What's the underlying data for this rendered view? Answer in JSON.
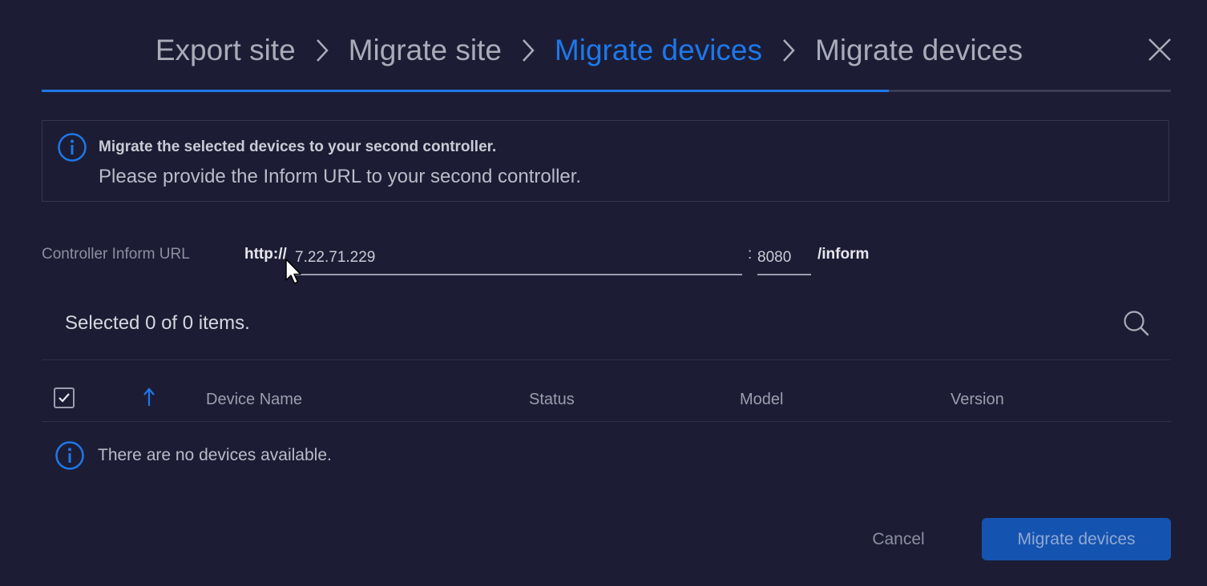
{
  "wizard": {
    "steps": [
      {
        "label": "Export site",
        "active": false
      },
      {
        "label": "Migrate site",
        "active": false
      },
      {
        "label": "Migrate devices",
        "active": true
      },
      {
        "label": "Migrate devices",
        "active": false
      }
    ],
    "progress": 0.75
  },
  "info": {
    "title": "Migrate the selected devices to your second controller.",
    "text": "Please provide the Inform URL to your second controller."
  },
  "url": {
    "label": "Controller Inform URL",
    "prefix": "http://",
    "host": "7.22.71.229",
    "colon": ":",
    "port": "8080",
    "suffix": "/inform"
  },
  "table": {
    "selected_text": "Selected 0 of 0 items.",
    "columns": [
      "Device Name",
      "Status",
      "Model",
      "Version"
    ],
    "empty_text": "There are no devices available."
  },
  "footer": {
    "cancel_label": "Cancel",
    "migrate_label": "Migrate devices"
  },
  "colors": {
    "accent": "#1f77ea",
    "background": "#1c1d34",
    "primary_button": "#1553b0"
  },
  "icons": [
    "chevron-right-icon",
    "close-icon",
    "info-icon",
    "search-icon",
    "checkmark-icon",
    "sort-arrow-up-icon",
    "mouse-cursor-icon"
  ]
}
